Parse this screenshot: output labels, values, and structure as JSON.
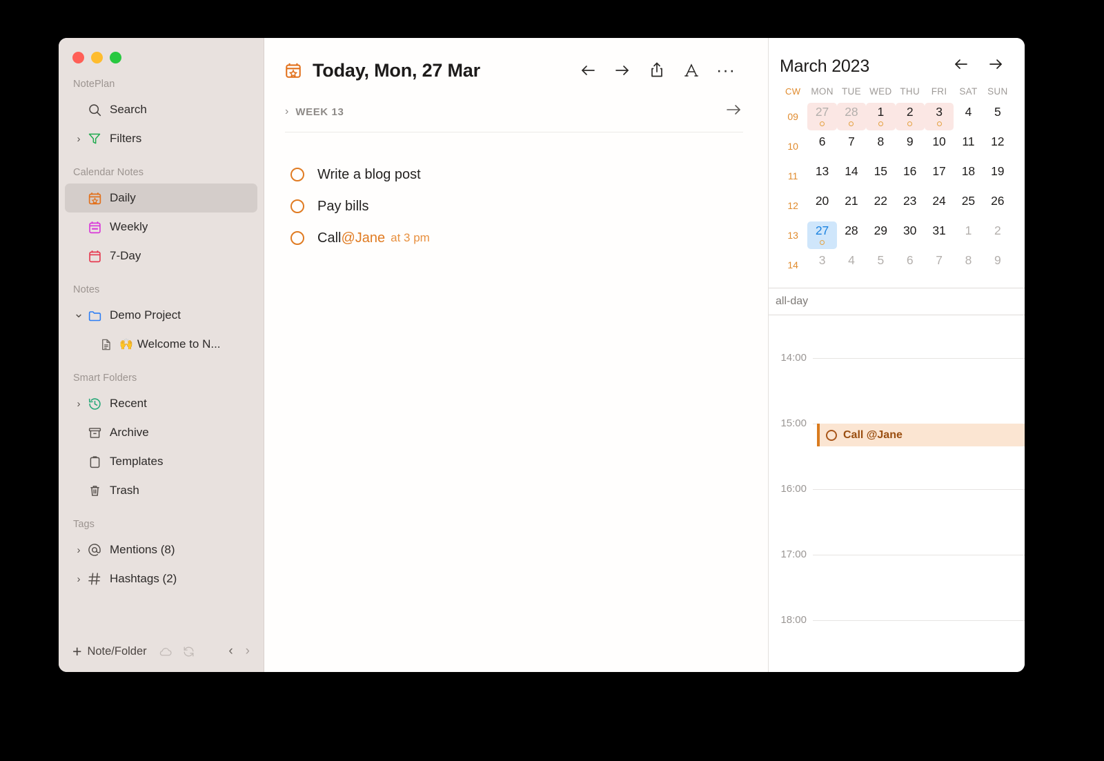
{
  "window": {
    "traffic_lights": [
      "close",
      "minimize",
      "zoom"
    ],
    "colors": {
      "accent_orange": "#e07b22",
      "sidebar_bg": "#e8e1de",
      "selected_bg": "#d4cdca",
      "today_blue": "#1a82e0",
      "cw_orange": "#e08b2e",
      "event_bg": "#fbe5d2"
    }
  },
  "sidebar": {
    "headings": {
      "app": "NotePlan",
      "calendar_notes": "Calendar Notes",
      "notes": "Notes",
      "smart_folders": "Smart Folders",
      "tags": "Tags"
    },
    "top_items": [
      {
        "label": "Search",
        "icon": "search-icon",
        "chevron": ""
      },
      {
        "label": "Filters",
        "icon": "filter-icon",
        "chevron": "›"
      }
    ],
    "calendar_items": [
      {
        "label": "Daily",
        "icon": "calendar-star-icon",
        "selected": true
      },
      {
        "label": "Weekly",
        "icon": "calendar-weekly-icon",
        "selected": false
      },
      {
        "label": "7-Day",
        "icon": "calendar-7day-icon",
        "selected": false
      }
    ],
    "notes_items": [
      {
        "label": "Demo Project",
        "icon": "folder-icon",
        "chevron": "⌄",
        "child": false
      },
      {
        "label": "Welcome to N...",
        "emoji": "🙌",
        "icon": "document-icon",
        "child": true
      }
    ],
    "smart_folder_items": [
      {
        "label": "Recent",
        "icon": "history-icon",
        "chevron": "›"
      },
      {
        "label": "Archive",
        "icon": "archive-icon",
        "chevron": ""
      },
      {
        "label": "Templates",
        "icon": "clipboard-icon",
        "chevron": ""
      },
      {
        "label": "Trash",
        "icon": "trash-icon",
        "chevron": ""
      }
    ],
    "tag_items": [
      {
        "label": "Mentions (8)",
        "icon": "at-icon",
        "chevron": "›"
      },
      {
        "label": "Hashtags (2)",
        "icon": "hashtag-icon",
        "chevron": "›"
      }
    ],
    "bottom_bar": {
      "new_label": "Note/Folder",
      "plus": "+",
      "back_arrow": "‹",
      "forward_arrow": "›"
    }
  },
  "main": {
    "title": "Today, Mon, 27 Mar",
    "title_icon": "calendar-star-icon",
    "toolbar": [
      {
        "name": "back-button",
        "glyph": "←"
      },
      {
        "name": "forward-button",
        "glyph": "→"
      },
      {
        "name": "share-button",
        "glyph": "share-icon"
      },
      {
        "name": "text-format-button",
        "glyph": "A"
      },
      {
        "name": "more-options-button",
        "glyph": "···"
      }
    ],
    "week": {
      "label": "WEEK 13",
      "chevron": "›",
      "jump_arrow": "→"
    },
    "todos": [
      {
        "text": "Write a blog post",
        "mention": "",
        "suffix": "",
        "state": "open"
      },
      {
        "text": "Pay bills",
        "mention": "",
        "suffix": "",
        "state": "open"
      },
      {
        "text": "Call ",
        "mention": "@Jane",
        "suffix": "at  3  pm",
        "state": "open"
      }
    ]
  },
  "calendar": {
    "title": "March 2023",
    "prev_arrow": "←",
    "next_arrow": "→",
    "columns": [
      "CW",
      "MON",
      "TUE",
      "WED",
      "THU",
      "FRI",
      "SAT",
      "SUN"
    ],
    "weeks": [
      {
        "cw": "09",
        "days": [
          {
            "n": "27",
            "muted": true,
            "pink": true,
            "dot": true
          },
          {
            "n": "28",
            "muted": true,
            "pink": true,
            "dot": true
          },
          {
            "n": "1",
            "muted": false,
            "pink": true,
            "dot": true
          },
          {
            "n": "2",
            "muted": false,
            "pink": true,
            "dot": true
          },
          {
            "n": "3",
            "muted": false,
            "pink": true,
            "dot": true
          },
          {
            "n": "4",
            "muted": false,
            "pink": false,
            "dot": false
          },
          {
            "n": "5",
            "muted": false,
            "pink": false,
            "dot": false
          }
        ]
      },
      {
        "cw": "10",
        "days": [
          {
            "n": "6",
            "muted": false,
            "pink": false,
            "dot": false
          },
          {
            "n": "7",
            "muted": false,
            "pink": false,
            "dot": false
          },
          {
            "n": "8",
            "muted": false,
            "pink": false,
            "dot": false
          },
          {
            "n": "9",
            "muted": false,
            "pink": false,
            "dot": false
          },
          {
            "n": "10",
            "muted": false,
            "pink": false,
            "dot": false
          },
          {
            "n": "11",
            "muted": false,
            "pink": false,
            "dot": false
          },
          {
            "n": "12",
            "muted": false,
            "pink": false,
            "dot": false
          }
        ]
      },
      {
        "cw": "11",
        "days": [
          {
            "n": "13",
            "muted": false,
            "pink": false,
            "dot": false
          },
          {
            "n": "14",
            "muted": false,
            "pink": false,
            "dot": false
          },
          {
            "n": "15",
            "muted": false,
            "pink": false,
            "dot": false
          },
          {
            "n": "16",
            "muted": false,
            "pink": false,
            "dot": false
          },
          {
            "n": "17",
            "muted": false,
            "pink": false,
            "dot": false
          },
          {
            "n": "18",
            "muted": false,
            "pink": false,
            "dot": false
          },
          {
            "n": "19",
            "muted": false,
            "pink": false,
            "dot": false
          }
        ]
      },
      {
        "cw": "12",
        "days": [
          {
            "n": "20",
            "muted": false,
            "pink": false,
            "dot": false
          },
          {
            "n": "21",
            "muted": false,
            "pink": false,
            "dot": false
          },
          {
            "n": "22",
            "muted": false,
            "pink": false,
            "dot": false
          },
          {
            "n": "23",
            "muted": false,
            "pink": false,
            "dot": false
          },
          {
            "n": "24",
            "muted": false,
            "pink": false,
            "dot": false
          },
          {
            "n": "25",
            "muted": false,
            "pink": false,
            "dot": false
          },
          {
            "n": "26",
            "muted": false,
            "pink": false,
            "dot": false
          }
        ]
      },
      {
        "cw": "13",
        "days": [
          {
            "n": "27",
            "muted": false,
            "today": true,
            "dot": true
          },
          {
            "n": "28",
            "muted": false,
            "pink": false,
            "dot": false
          },
          {
            "n": "29",
            "muted": false,
            "pink": false,
            "dot": false
          },
          {
            "n": "30",
            "muted": false,
            "pink": false,
            "dot": false
          },
          {
            "n": "31",
            "muted": false,
            "pink": false,
            "dot": false
          },
          {
            "n": "1",
            "muted": true,
            "pink": false,
            "dot": false
          },
          {
            "n": "2",
            "muted": true,
            "pink": false,
            "dot": false
          }
        ]
      },
      {
        "cw": "14",
        "days": [
          {
            "n": "3",
            "muted": true,
            "pink": false,
            "dot": false
          },
          {
            "n": "4",
            "muted": true,
            "pink": false,
            "dot": false
          },
          {
            "n": "5",
            "muted": true,
            "pink": false,
            "dot": false
          },
          {
            "n": "6",
            "muted": true,
            "pink": false,
            "dot": false
          },
          {
            "n": "7",
            "muted": true,
            "pink": false,
            "dot": false
          },
          {
            "n": "8",
            "muted": true,
            "pink": false,
            "dot": false
          },
          {
            "n": "9",
            "muted": true,
            "pink": false,
            "dot": false
          }
        ]
      }
    ],
    "allday_label": "all-day",
    "hours": [
      "14:00",
      "15:00",
      "16:00",
      "17:00",
      "18:00"
    ],
    "events": [
      {
        "title": "Call @Jane",
        "start": "15:00",
        "state": "open"
      }
    ]
  }
}
